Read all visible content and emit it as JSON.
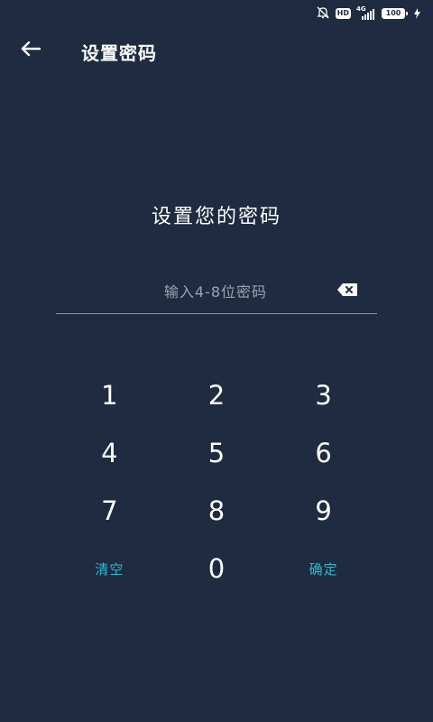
{
  "status_bar": {
    "network": "4G",
    "hd": "HD",
    "battery": "100",
    "icons": [
      "mute-icon",
      "hd-icon",
      "signal-icon",
      "battery-icon",
      "charging-icon"
    ]
  },
  "header": {
    "title": "设置密码",
    "back_icon": "arrow-left-icon"
  },
  "prompt": "设置您的密码",
  "password_input": {
    "value": "",
    "placeholder": "输入4-8位密码",
    "clear_icon": "backspace-icon"
  },
  "keypad": {
    "keys": [
      "1",
      "2",
      "3",
      "4",
      "5",
      "6",
      "7",
      "8",
      "9"
    ],
    "clear_label": "清空",
    "zero": "0",
    "confirm_label": "确定"
  },
  "colors": {
    "background": "#1e2b40",
    "accent": "#2bbcd0",
    "text": "#ffffff",
    "placeholder": "#9aa4b2"
  }
}
